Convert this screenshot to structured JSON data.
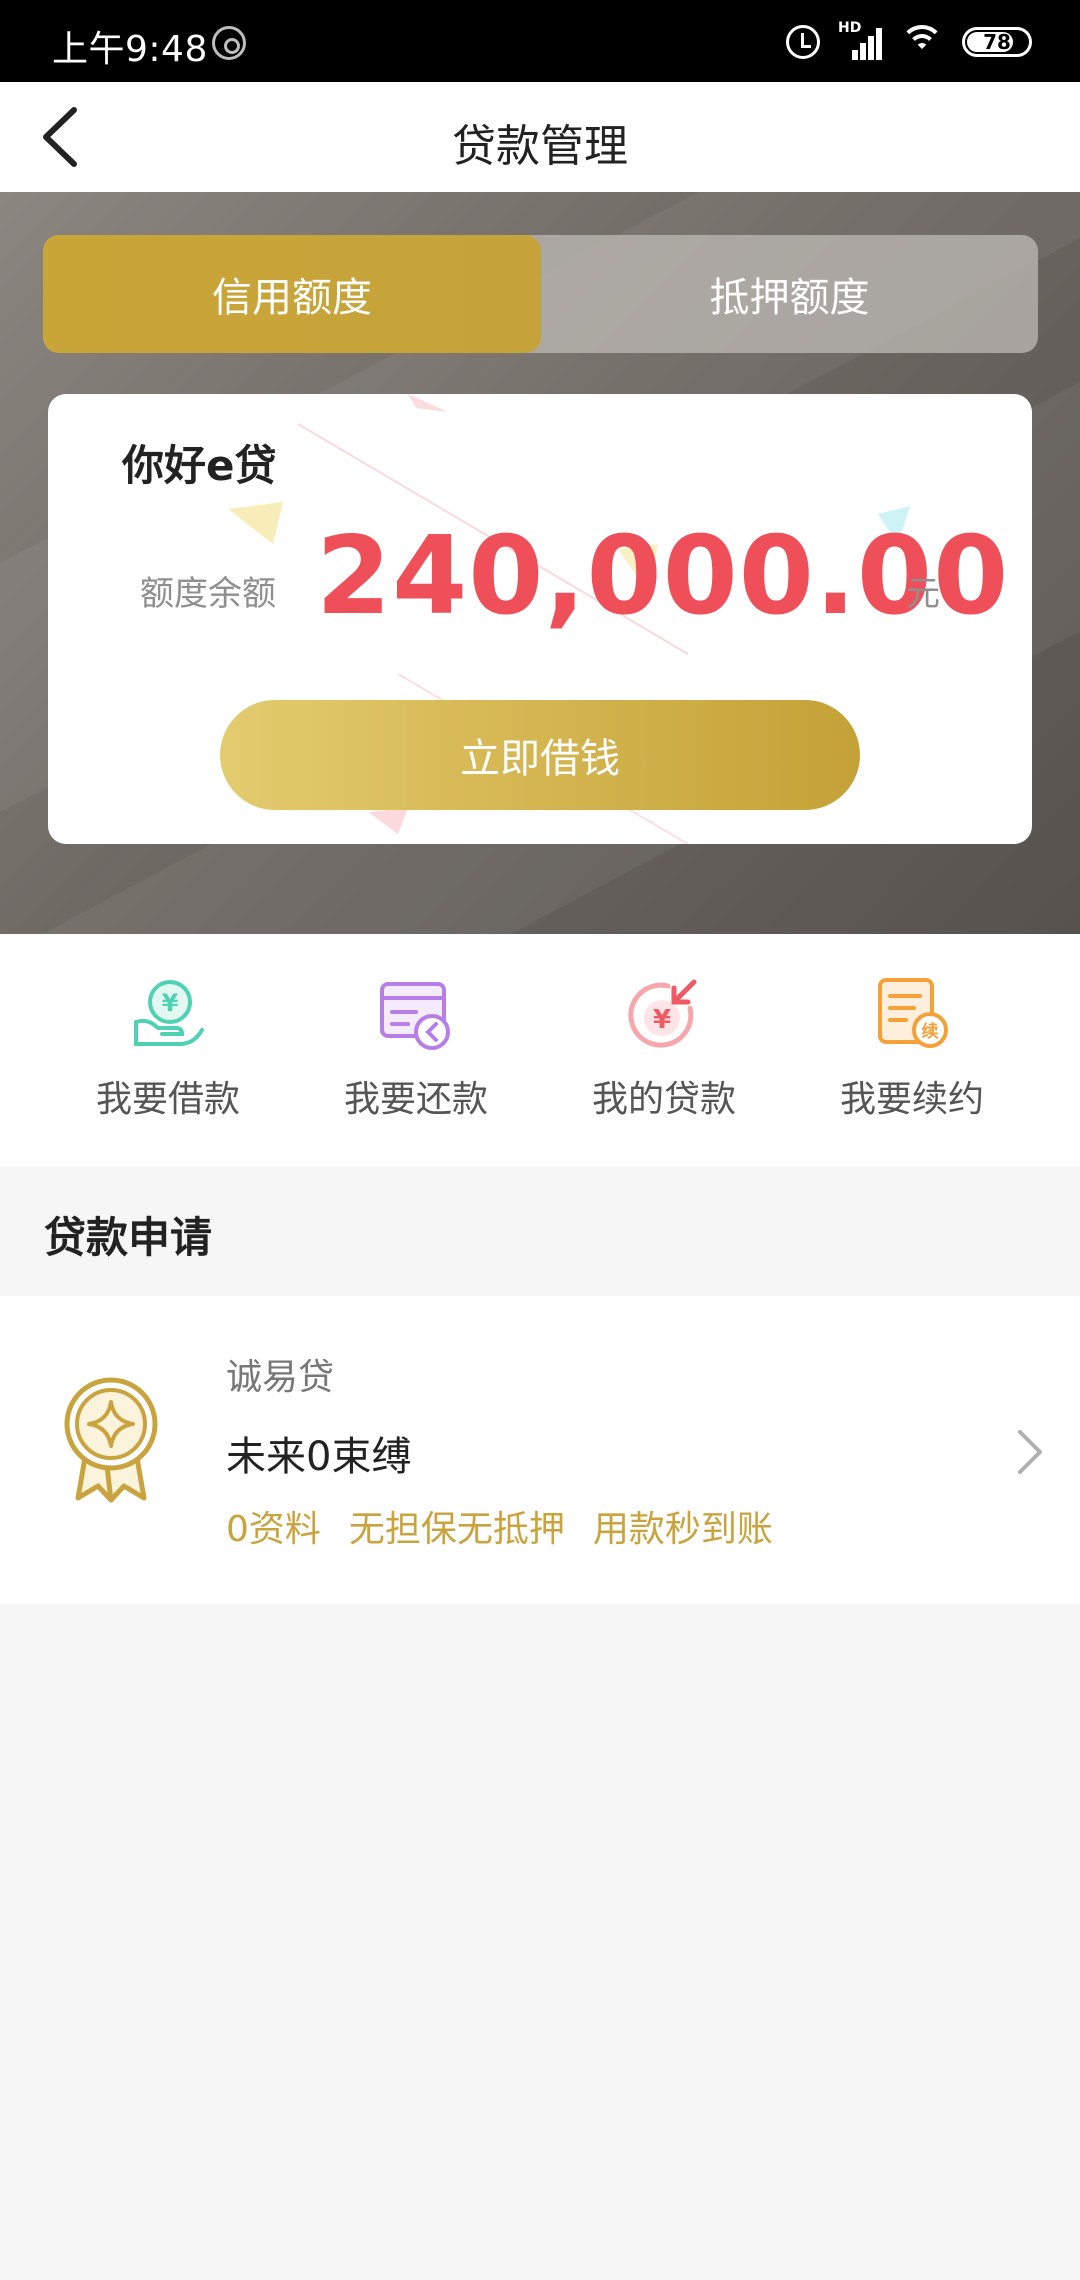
{
  "status_bar": {
    "time": "上午9:48",
    "battery": "78",
    "network": "HD"
  },
  "nav": {
    "title": "贷款管理"
  },
  "tabs": [
    {
      "label": "信用额度",
      "active": true
    },
    {
      "label": "抵押额度",
      "active": false
    }
  ],
  "card": {
    "title": "你好e贷",
    "balance_label": "额度余额",
    "balance_amount": "240,000.00",
    "balance_unit": "元",
    "borrow_label": "立即借钱"
  },
  "actions": [
    {
      "label": "我要借款",
      "icon": "hand-yuan-icon",
      "color": "#4fd1b4"
    },
    {
      "label": "我要还款",
      "icon": "card-return-icon",
      "color": "#b77ee8"
    },
    {
      "label": "我的贷款",
      "icon": "yuan-circle-arrow-icon",
      "color": "#f05a66"
    },
    {
      "label": "我要续约",
      "icon": "document-renew-icon",
      "color": "#f5a13a"
    }
  ],
  "loan_section": {
    "title": "贷款申请",
    "product": {
      "name": "诚易贷",
      "slogan": "未来0束缚",
      "tags": [
        "0资料",
        "无担保无抵押",
        "用款秒到账"
      ]
    }
  },
  "colors": {
    "gold": "#c9a43e",
    "amount_red": "#ef4f58"
  }
}
